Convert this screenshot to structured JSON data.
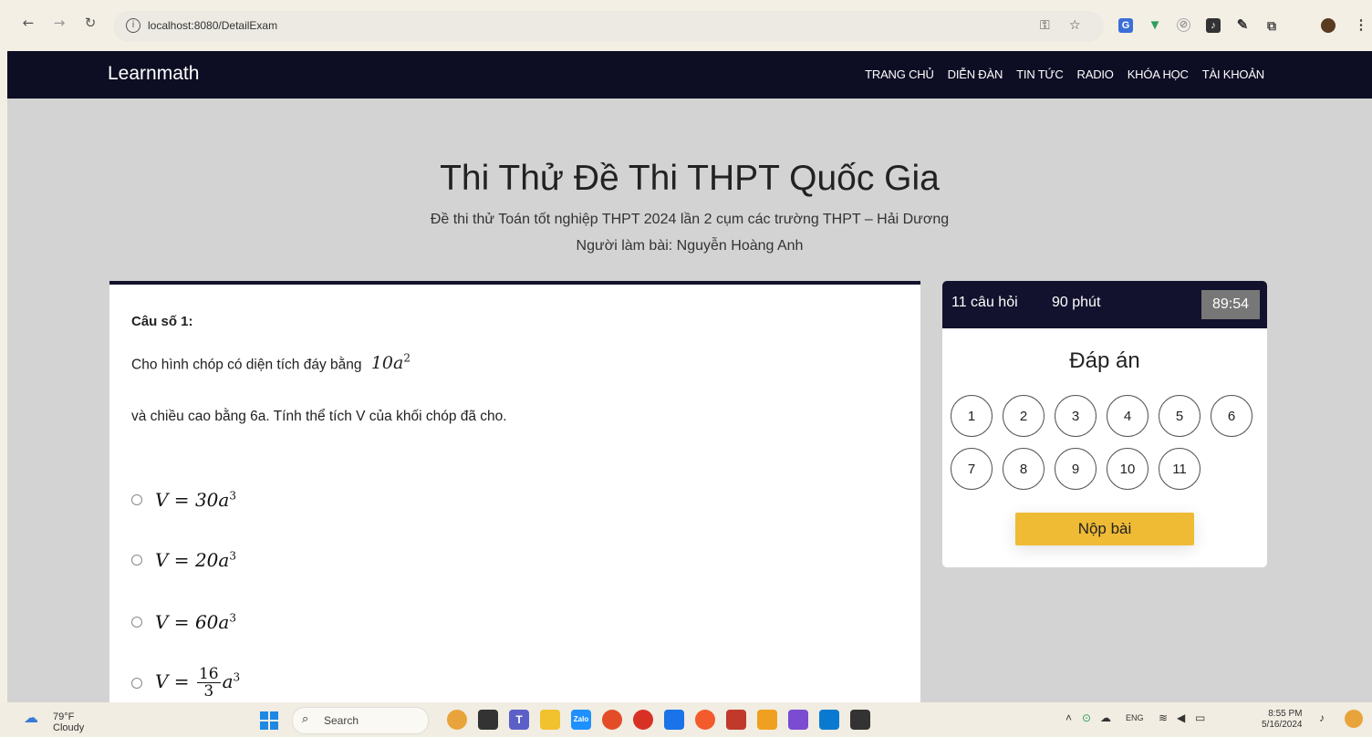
{
  "browser": {
    "url": "localhost:8080/DetailExam",
    "back_icon": "arrow-left-icon",
    "forward_icon": "arrow-right-icon",
    "reload_icon": "reload-icon"
  },
  "site": {
    "brand": "Learnmath",
    "menu": [
      "TRANG CHỦ",
      "DIỄN ĐÀN",
      "TIN TỨC",
      "RADIO",
      "KHÓA HỌC",
      "TÀI KHOẢN"
    ]
  },
  "exam": {
    "title": "Thi Thử Đề Thi THPT Quốc Gia",
    "subtitle": "Đề thi thử Toán tốt nghiệp THPT 2024 lần 2 cụm các trường THPT – Hải Dương",
    "taker": "Người làm bài: Nguyễn Hoàng Anh"
  },
  "question": {
    "label": "Câu số 1:",
    "line1": "Cho hình chóp có diện tích đáy bằng",
    "line1_math_base": "10a",
    "line1_math_exp": "2",
    "line2": "và chiều cao bằng 6a. Tính thể tích V của khối chóp đã cho.",
    "options": [
      {
        "lhs": "V",
        "eq": " = ",
        "coef": "30a",
        "exp": "3"
      },
      {
        "lhs": "V",
        "eq": " = ",
        "coef": "20a",
        "exp": "3"
      },
      {
        "lhs": "V",
        "eq": " = ",
        "coef": "60a",
        "exp": "3"
      },
      {
        "lhs": "V",
        "eq": " = ",
        "num": "16",
        "den": "3",
        "coef": "a",
        "exp": "3"
      }
    ]
  },
  "panel": {
    "count": "11 câu hỏi",
    "duration": "90 phút",
    "timer": "89:54",
    "answers_title": "Đáp án",
    "numbers": [
      "1",
      "2",
      "3",
      "4",
      "5",
      "6",
      "7",
      "8",
      "9",
      "10",
      "11"
    ],
    "submit": "Nộp bài"
  },
  "taskbar": {
    "temp": "79°F",
    "weather": "Cloudy",
    "search": "Search",
    "lang": "ENG",
    "time": "8:55 PM",
    "date": "5/16/2024"
  }
}
